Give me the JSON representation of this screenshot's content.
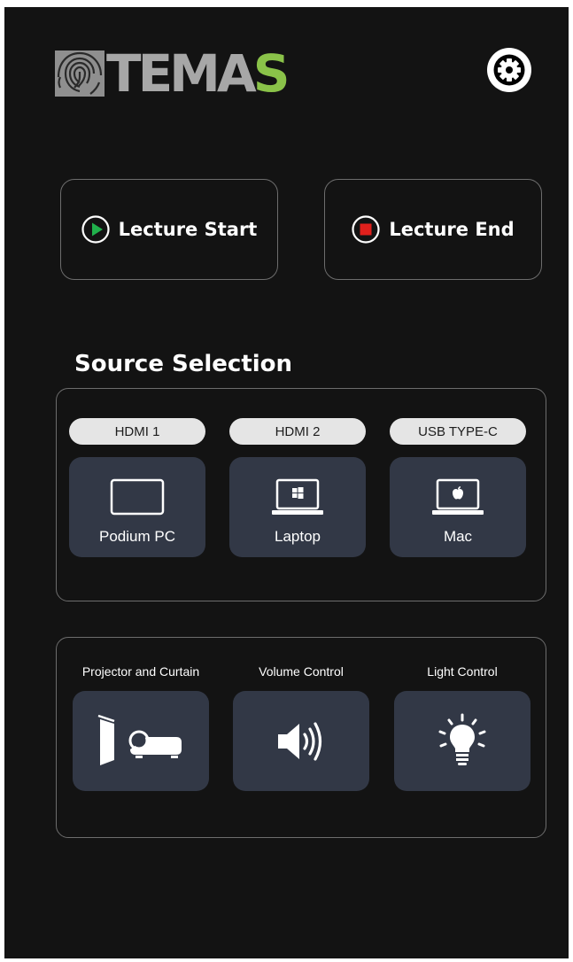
{
  "header": {
    "logo_text_main": "TEMA",
    "logo_text_accent": "S",
    "settings_icon": "gear-icon"
  },
  "lecture": {
    "start_label": "Lecture Start",
    "start_icon": "play-icon",
    "end_label": "Lecture End",
    "end_icon": "stop-icon"
  },
  "source_selection": {
    "title": "Source Selection",
    "sources": [
      {
        "port": "HDMI 1",
        "device": "Podium PC",
        "icon": "monitor-icon"
      },
      {
        "port": "HDMI 2",
        "device": "Laptop",
        "icon": "windows-laptop-icon"
      },
      {
        "port": "USB TYPE-C",
        "device": "Mac",
        "icon": "mac-laptop-icon"
      }
    ]
  },
  "controls": [
    {
      "label": "Projector and Curtain",
      "icon": "projector-curtain-icon"
    },
    {
      "label": "Volume Control",
      "icon": "speaker-icon"
    },
    {
      "label": "Light Control",
      "icon": "lightbulb-icon"
    }
  ],
  "colors": {
    "background": "#131313",
    "tile": "#323846",
    "logo_gray": "#a7a7a7",
    "logo_green": "#8ac249",
    "play_green": "#21b14c",
    "stop_red": "#e0201c"
  }
}
